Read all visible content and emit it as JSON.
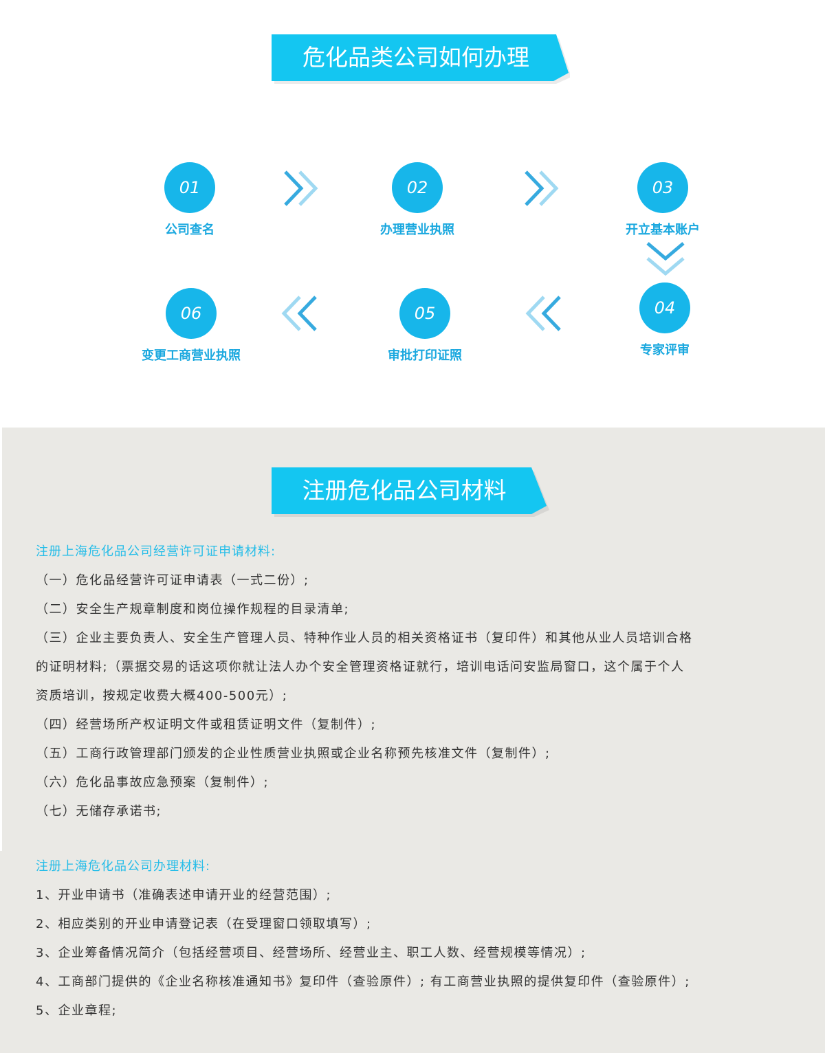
{
  "section1": {
    "title": "危化品类公司如何办理",
    "steps": [
      {
        "number": "01",
        "label": "公司查名"
      },
      {
        "number": "02",
        "label": "办理营业执照"
      },
      {
        "number": "03",
        "label": "开立基本账户"
      },
      {
        "number": "04",
        "label": "专家评审"
      },
      {
        "number": "05",
        "label": "审批打印证照"
      },
      {
        "number": "06",
        "label": "变更工商营业执照"
      }
    ]
  },
  "section2": {
    "title": "注册危化品公司材料",
    "block1": {
      "heading": "注册上海危化品公司经营许可证申请材料:",
      "items": [
        "（一）危化品经营许可证申请表（一式二份）;",
        "（二）安全生产规章制度和岗位操作规程的目录清单;",
        "（三）企业主要负责人、安全生产管理人员、特种作业人员的相关资格证书（复印件）和其他从业人员培训合格",
        "的证明材料;（票据交易的话这项你就让法人办个安全管理资格证就行，培训电话问安监局窗口，这个属于个人",
        "资质培训，按规定收费大概400-500元）;",
        "（四）经营场所产权证明文件或租赁证明文件（复制件）;",
        "（五）工商行政管理部门颁发的企业性质营业执照或企业名称预先核准文件（复制件）;",
        "（六）危化品事故应急预案（复制件）;",
        "（七）无储存承诺书;"
      ]
    },
    "block2": {
      "heading": "注册上海危化品公司办理材料:",
      "items": [
        "1、开业申请书（准确表述申请开业的经营范围）;",
        "2、相应类别的开业申请登记表（在受理窗口领取填写）;",
        "3、企业筹备情况简介（包括经营项目、经营场所、经营业主、职工人数、经营规模等情况）;",
        "4、工商部门提供的《企业名称核准通知书》复印件（查验原件）; 有工商营业执照的提供复印件（查验原件）;",
        "5、企业章程;"
      ]
    }
  },
  "colors": {
    "banner": "#14c6f1",
    "circle": "#17b6ea",
    "label": "#1aa8df",
    "subhead": "#27bde8",
    "section2_bg": "#eae9e5"
  }
}
